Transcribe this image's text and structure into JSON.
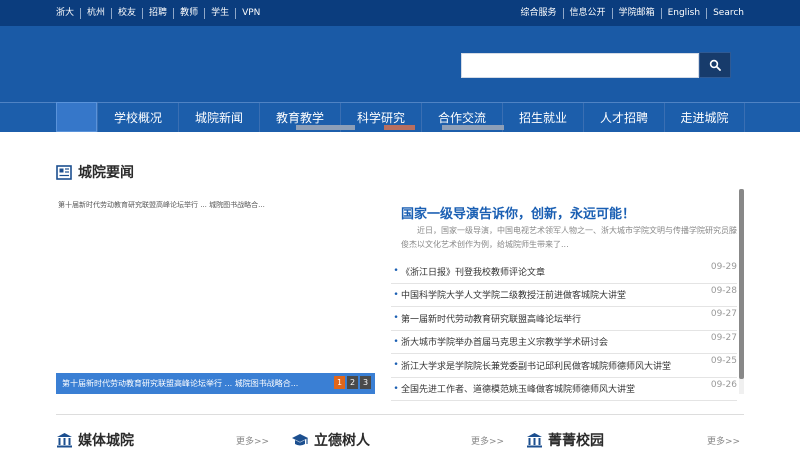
{
  "topbar": {
    "left_links": [
      "浙大",
      "杭州",
      "校友",
      "招聘",
      "教师",
      "学生",
      "VPN"
    ],
    "right_links": [
      "综合服务",
      "信息公开",
      "学院邮箱",
      "English",
      "Search"
    ]
  },
  "search": {
    "placeholder": ""
  },
  "nav": {
    "items": [
      "学校概况",
      "城院新闻",
      "教育教学",
      "科学研究",
      "合作交流",
      "招生就业",
      "人才招聘",
      "走进城院"
    ]
  },
  "news_section": {
    "title": "城院要闻",
    "slider": {
      "caption_top": "第十届新时代劳动教育研究联盟高峰论坛举行 ... 城院图书战略合...",
      "caption_bottom": "第十届新时代劳动教育研究联盟高峰论坛举行 ... 城院图书战略合...",
      "pages": [
        "1",
        "2",
        "3"
      ],
      "active_page": "1"
    },
    "featured": {
      "title": "国家一级导演告诉你，创新，永远可能！",
      "summary": "近日，国家一级导演，中国电视艺术领军人物之一、浙大城市学院文明与传播学院研究员滕俊杰以文化艺术创作为例，给城院师生带来了..."
    },
    "items": [
      {
        "title": "《浙江日报》刊登我校教师评论文章",
        "date": "09-29"
      },
      {
        "title": "中国科学院大学人文学院二级教授汪前进做客城院大讲堂",
        "date": "09-28"
      },
      {
        "title": "第一届新时代劳动教育研究联盟高峰论坛举行",
        "date": "09-27"
      },
      {
        "title": "浙大城市学院举办首届马克思主义宗教学学术研讨会",
        "date": "09-27"
      },
      {
        "title": "浙江大学求是学院院长兼党委副书记邱利民做客城院师德师风大讲堂",
        "date": "09-25"
      },
      {
        "title": "全国先进工作者、道德模范姚玉峰做客城院师德师风大讲堂",
        "date": "09-26"
      }
    ]
  },
  "bottom_sections": [
    {
      "title": "媒体城院",
      "more": "更多>>"
    },
    {
      "title": "立德树人",
      "more": "更多>>"
    },
    {
      "title": "菁菁校园",
      "more": "更多>>"
    }
  ],
  "colors": {
    "topbar": "#0b3d7e",
    "banner": "#1a5aa6",
    "nav": "#1c5eab",
    "accent": "#1a5fb3",
    "slider_active": "#e0661b"
  }
}
